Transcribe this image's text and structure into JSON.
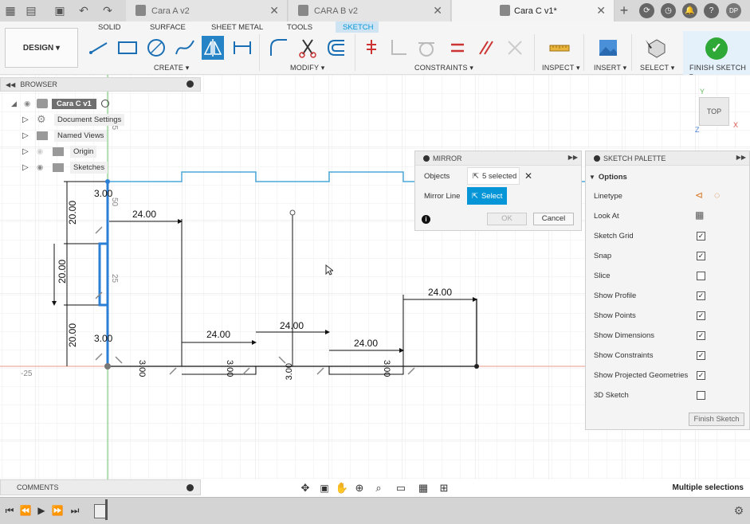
{
  "titlebar": {
    "tabs": [
      {
        "label": "Cara A v2",
        "active": false
      },
      {
        "label": "CARA B v2",
        "active": false
      },
      {
        "label": "Cara C v1*",
        "active": true
      }
    ],
    "user_initials": "DP"
  },
  "toolbar": {
    "workspace": "DESIGN",
    "menu_tabs": [
      "SOLID",
      "SURFACE",
      "SHEET METAL",
      "TOOLS",
      "SKETCH"
    ],
    "groups": [
      "CREATE",
      "MODIFY",
      "CONSTRAINTS",
      "INSPECT",
      "INSERT",
      "SELECT",
      "FINISH SKETCH"
    ]
  },
  "browser": {
    "title": "BROWSER",
    "root": "Cara C v1",
    "items": [
      "Document Settings",
      "Named Views",
      "Origin",
      "Sketches"
    ]
  },
  "mirror": {
    "title": "MIRROR",
    "objects_label": "Objects",
    "objects_value": "5 selected",
    "mirror_line_label": "Mirror Line",
    "mirror_line_value": "Select",
    "ok": "OK",
    "cancel": "Cancel"
  },
  "palette": {
    "title": "SKETCH PALETTE",
    "section": "Options",
    "rows": [
      {
        "label": "Linetype",
        "type": "icons"
      },
      {
        "label": "Look At",
        "type": "icon"
      },
      {
        "label": "Sketch Grid",
        "checked": true
      },
      {
        "label": "Snap",
        "checked": true
      },
      {
        "label": "Slice",
        "checked": false
      },
      {
        "label": "Show Profile",
        "checked": true
      },
      {
        "label": "Show Points",
        "checked": true
      },
      {
        "label": "Show Dimensions",
        "checked": true
      },
      {
        "label": "Show Constraints",
        "checked": true
      },
      {
        "label": "Show Projected Geometries",
        "checked": true
      },
      {
        "label": "3D Sketch",
        "checked": false
      }
    ],
    "finish_label": "Finish Sketch"
  },
  "viewcube": {
    "label": "TOP",
    "x": "X",
    "y": "Y",
    "z": "Z"
  },
  "dimensions": {
    "d1": "3.00",
    "d2": "20.00",
    "d3": "20.00",
    "d4": "20.00",
    "d5": "3.00",
    "d6": "24.00",
    "d7": "24.00",
    "d8": "24.00",
    "d9": "24.00",
    "d10": "24.00",
    "d11": "3.00",
    "d12": "3.00",
    "d13": "3.00",
    "d14": "3.00",
    "d15": "50",
    "d16": "25",
    "d17": "-25",
    "d18": "25"
  },
  "comments": {
    "title": "COMMENTS"
  },
  "status": "Multiple selections"
}
